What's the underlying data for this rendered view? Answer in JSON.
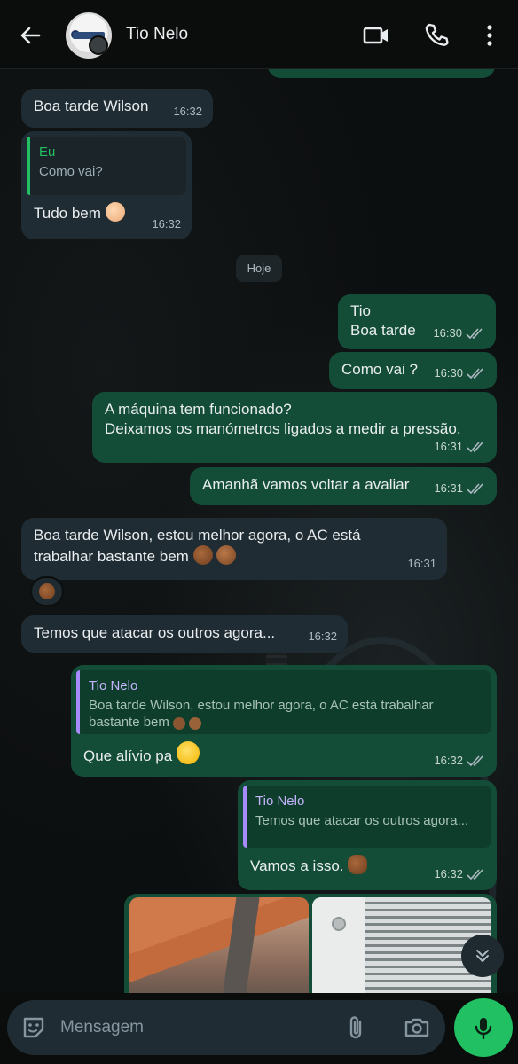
{
  "header": {
    "contact_name": "Tio Nelo"
  },
  "messages": [
    {
      "text": "Boa tarde Wilson",
      "time": "16:32"
    },
    {
      "quote_author": "Eu",
      "quote_text": "Como vai?",
      "text": "Tudo bem",
      "time": "16:32"
    },
    {
      "date_chip": "Hoje"
    },
    {
      "line1": "Tio",
      "line2": "Boa tarde",
      "time": "16:30"
    },
    {
      "text": "Como vai ?",
      "time": "16:30"
    },
    {
      "line1": "A máquina tem funcionado?",
      "line2": "Deixamos os manómetros ligados a medir a pressão.",
      "time": "16:31"
    },
    {
      "text": "Amanhã vamos voltar a avaliar",
      "time": "16:31"
    },
    {
      "line1": "Boa tarde Wilson, estou melhor agora, o AC está",
      "line2": "trabalhar bastante bem",
      "time": "16:31"
    },
    {
      "text": "Temos que atacar os outros agora...",
      "time": "16:32"
    },
    {
      "quote_author": "Tio Nelo",
      "quote_line1": "Boa tarde Wilson, estou melhor agora, o AC está trabalhar",
      "quote_line2": "bastante bem",
      "text": "Que alívio pa",
      "time": "16:32"
    },
    {
      "quote_author": "Tio Nelo",
      "quote_text": "Temos que atacar os outros agora...",
      "text": "Vamos a isso.",
      "time": "16:32"
    }
  ],
  "input": {
    "placeholder": "Mensagem"
  },
  "colors": {
    "incoming_bubble": "#202c33",
    "outgoing_bubble": "#134d37",
    "accent_green": "#21c063",
    "quote_purple": "#a78bfa"
  },
  "icons": [
    "back-arrow-icon",
    "video-call-icon",
    "phone-icon",
    "more-options-icon",
    "sticker-icon",
    "attach-icon",
    "camera-icon",
    "mic-icon",
    "double-check-icon",
    "scroll-down-icon"
  ]
}
